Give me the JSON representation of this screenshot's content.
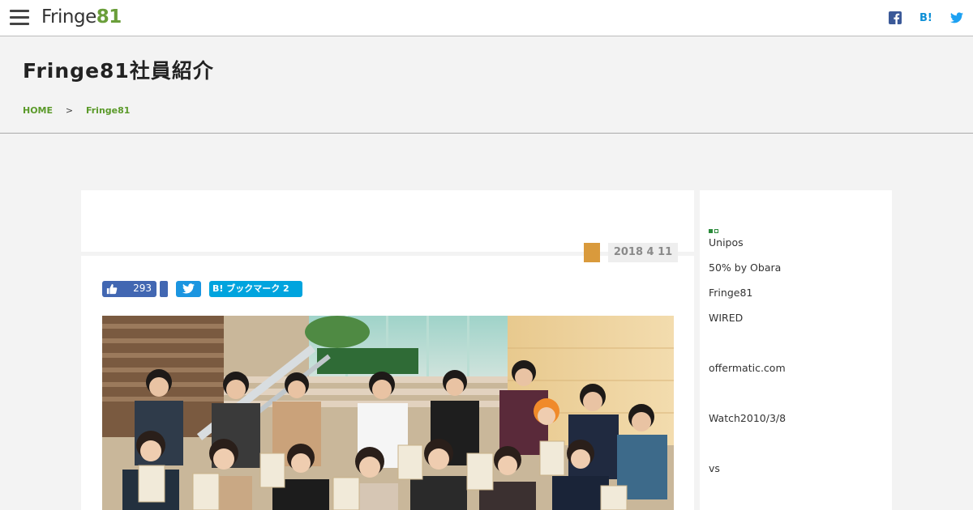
{
  "site": {
    "logo_part1": "Fringe",
    "logo_part2": "81"
  },
  "header": {
    "title": "Fringe81社員紹介"
  },
  "breadcrumb": {
    "home": "HOME",
    "separator": ">",
    "current": "Fringe81"
  },
  "article": {
    "date": "2018 4 11",
    "category_color": "#d99a3c",
    "share": {
      "like_count": "293",
      "hatena_label": "B! ブックマーク 2"
    }
  },
  "sidebar": {
    "items": [
      "Unipos",
      "50% by Obara",
      "Fringe81",
      "WIRED",
      "offermatic.com",
      "Watch2010/3/8",
      "vs"
    ]
  },
  "top_share": {
    "hatena_label": "B!"
  },
  "colors": {
    "accent_green": "#5b9a2a",
    "facebook": "#4267b2",
    "twitter": "#1b95e0",
    "hatena": "#00a4de"
  }
}
